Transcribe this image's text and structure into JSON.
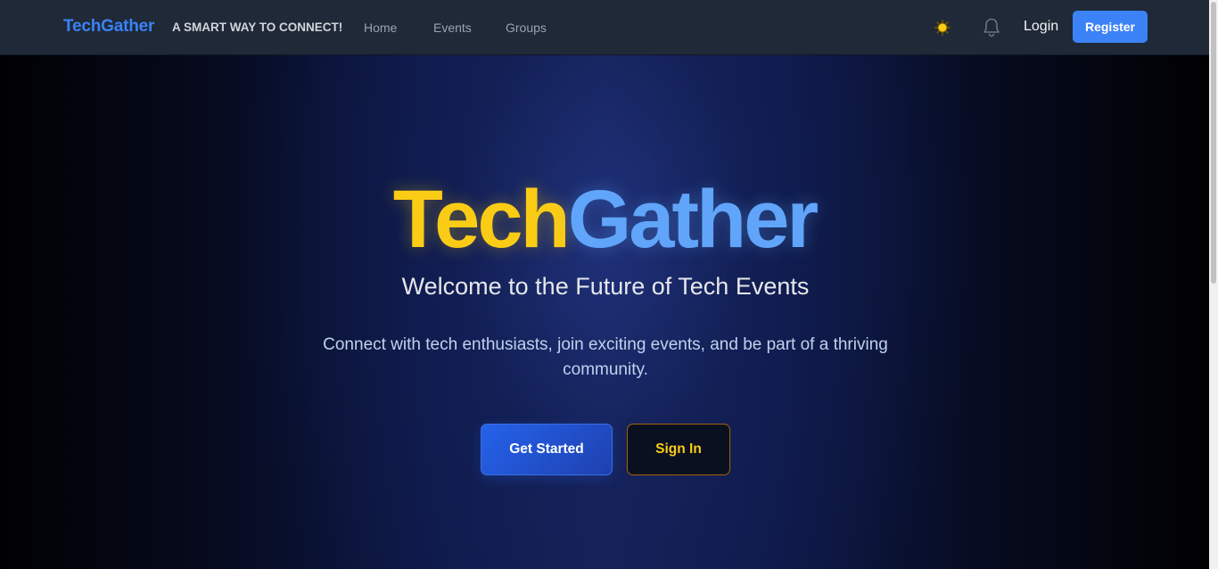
{
  "navbar": {
    "brand": "TechGather",
    "tagline": "A SMART WAY TO CONNECT!",
    "links": [
      "Home",
      "Events",
      "Groups"
    ],
    "theme_icon": "sun-icon",
    "bell_icon": "bell-icon",
    "login_label": "Login",
    "register_label": "Register"
  },
  "hero": {
    "title_part1": "Tech",
    "title_part2": "Gather",
    "subtitle": "Welcome to the Future of Tech Events",
    "description": "Connect with tech enthusiasts, join exciting events, and be part of a thriving community.",
    "primary_button": "Get Started",
    "secondary_button": "Sign In"
  },
  "colors": {
    "accent_blue": "#3b82f6",
    "accent_yellow": "#facc15",
    "navbar_bg": "#1f2937",
    "title_blue": "#60a5fa"
  }
}
